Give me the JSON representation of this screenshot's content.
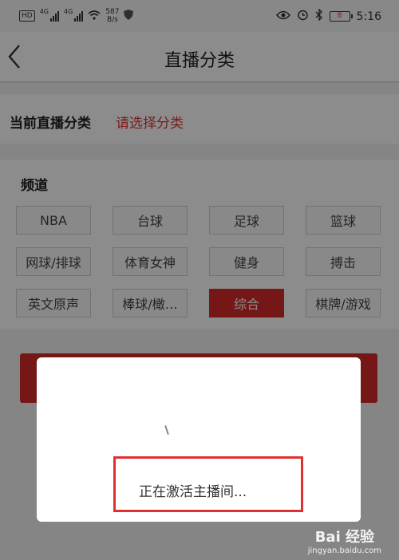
{
  "status_bar": {
    "hd": "HD",
    "net1": "4G",
    "net2": "4G",
    "speed_value": "587",
    "speed_unit": "B/s",
    "battery": "8",
    "time": "5:16"
  },
  "nav": {
    "back_icon": "chevron-left-icon",
    "title": "直播分类"
  },
  "current": {
    "label": "当前直播分类",
    "value": "请选择分类"
  },
  "channel": {
    "title": "频道",
    "items": [
      {
        "label": "NBA",
        "selected": false
      },
      {
        "label": "台球",
        "selected": false
      },
      {
        "label": "足球",
        "selected": false
      },
      {
        "label": "篮球",
        "selected": false
      },
      {
        "label": "网球/排球",
        "selected": false
      },
      {
        "label": "体育女神",
        "selected": false
      },
      {
        "label": "健身",
        "selected": false
      },
      {
        "label": "搏击",
        "selected": false
      },
      {
        "label": "英文原声",
        "selected": false
      },
      {
        "label": "棒球/橄…",
        "selected": false
      },
      {
        "label": "综合",
        "selected": true
      },
      {
        "label": "棋牌/游戏",
        "selected": false
      }
    ]
  },
  "dialog": {
    "message": "正在激活主播间..."
  },
  "watermark": {
    "logo": "Bai 经验",
    "url": "jingyan.baidu.com"
  },
  "colors": {
    "accent": "#d72a2a",
    "highlight": "#e03030"
  }
}
